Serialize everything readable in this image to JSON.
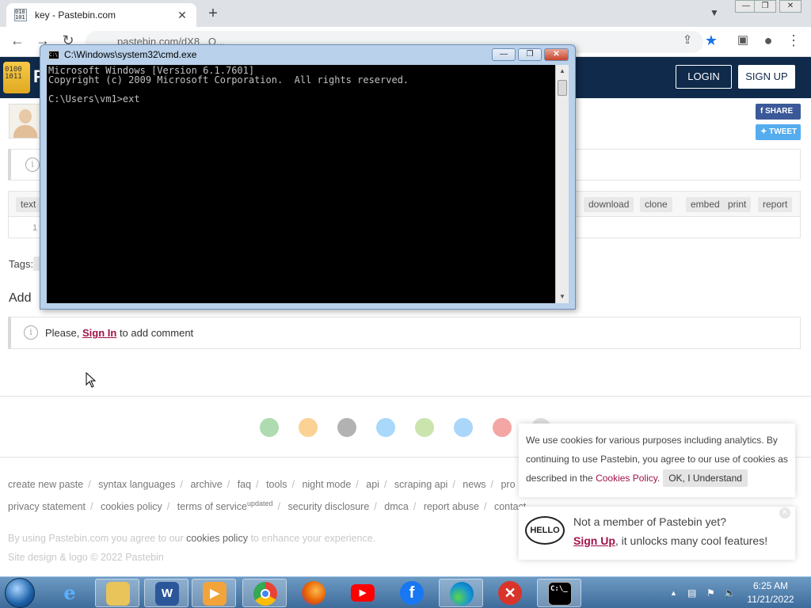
{
  "browser": {
    "tab_title": "key - Pastebin.com",
    "tab_close": "✕",
    "new_tab": "+",
    "url_partial": "pastebin.com/dX8...Q...",
    "window_controls": [
      "—",
      "❐",
      "✕"
    ]
  },
  "header": {
    "logo_text": "P",
    "login_label": "LOGIN",
    "signup_label": "SIGN UP"
  },
  "share": {
    "facebook": "SHARE",
    "twitter": "TWEET"
  },
  "code_toolbar": {
    "format": "text",
    "actions": [
      "download",
      "clone",
      "embed",
      "print",
      "report"
    ],
    "line_number": "1"
  },
  "tags_label": "Tags:",
  "add_comment_heading": "Add Comment",
  "comment_notice": {
    "prefix": "Please, ",
    "link": "Sign In",
    "suffix": " to add comment"
  },
  "footer": {
    "links_row1": [
      "create new paste",
      "syntax languages",
      "archive",
      "faq",
      "tools",
      "night mode",
      "api",
      "scraping api",
      "news",
      "pro"
    ],
    "links_row2": [
      "privacy statement",
      "cookies policy",
      "terms of service",
      "security disclosure",
      "dmca",
      "report abuse",
      "contact"
    ],
    "updated_badge": "updated",
    "legal_prefix": "By using Pastebin.com you agree to our ",
    "legal_link": "cookies policy",
    "legal_suffix": " to enhance your experience.",
    "copyright": "Site design & logo © 2022 Pastebin"
  },
  "cookie_popup": {
    "text": "We use cookies for various purposes including analytics. By continuing to use Pastebin, you agree to our use of cookies as described in the ",
    "link": "Cookies Policy",
    "after_link": ".",
    "button": "OK, I Understand"
  },
  "member_popup": {
    "badge": "HELLO",
    "line1": "Not a member of Pastebin yet?",
    "signup_link": "Sign Up",
    "line2_suffix": ", it unlocks many cool features!",
    "close": "✕"
  },
  "cmd": {
    "title": "C:\\Windows\\system32\\cmd.exe",
    "output": "Microsoft Windows [Version 6.1.7601]\nCopyright (c) 2009 Microsoft Corporation.  All rights reserved.\n\nC:\\Users\\vm1>ext",
    "buttons": [
      "—",
      "❐",
      "✕"
    ]
  },
  "taskbar": {
    "time": "6:25 AM",
    "date": "11/21/2022",
    "apps": [
      "internet-explorer",
      "file-explorer",
      "word",
      "media-player",
      "chrome",
      "firefox",
      "youtube",
      "facebook",
      "edge",
      "error-app",
      "cmd"
    ]
  }
}
